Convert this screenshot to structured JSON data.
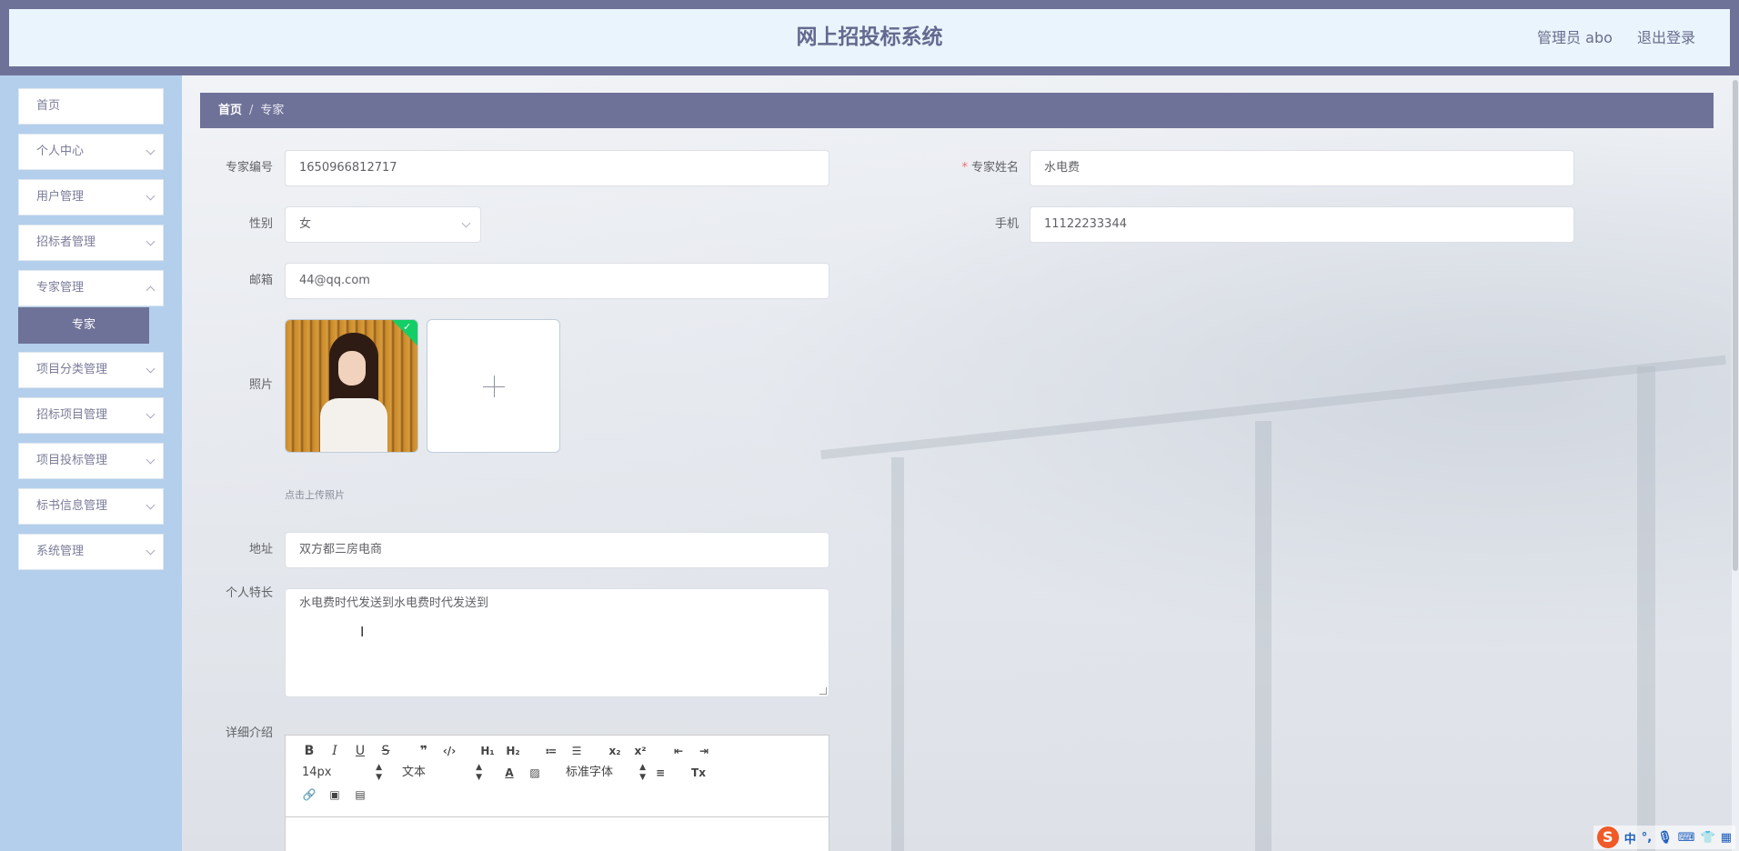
{
  "header": {
    "title": "网上招投标系统",
    "user_label": "管理员 abo",
    "logout_label": "退出登录"
  },
  "sidebar": {
    "items": [
      {
        "label": "首页"
      },
      {
        "label": "个人中心"
      },
      {
        "label": "用户管理"
      },
      {
        "label": "招标者管理"
      },
      {
        "label": "专家管理"
      },
      {
        "label": "项目分类管理"
      },
      {
        "label": "招标项目管理"
      },
      {
        "label": "项目投标管理"
      },
      {
        "label": "标书信息管理"
      },
      {
        "label": "系统管理"
      }
    ],
    "active_sub": "专家"
  },
  "breadcrumb": {
    "home": "首页",
    "sep": "/",
    "current": "专家"
  },
  "form": {
    "expert_no_label": "专家编号",
    "expert_no_value": "1650966812717",
    "expert_name_label": "专家姓名",
    "expert_name_required": "*",
    "expert_name_value": "水电费",
    "gender_label": "性别",
    "gender_value": "女",
    "phone_label": "手机",
    "phone_value": "11122233344",
    "email_label": "邮箱",
    "email_value": "44@qq.com",
    "photo_label": "照片",
    "photo_hint": "点击上传照片",
    "address_label": "地址",
    "address_value": "双方都三房电商",
    "specialty_label": "个人特长",
    "specialty_value": "水电费时代发送到水电费时代发送到",
    "detail_label": "详细介绍"
  },
  "editor": {
    "font_size": "14px",
    "format": "文本",
    "font": "标准字体"
  },
  "ime": {
    "lang": "中"
  },
  "colors": {
    "accent": "#6f7298",
    "sidebar_bg": "#b3cfec",
    "header_bg": "#e9f4fc",
    "required": "#f56c6c",
    "success": "#13ce66"
  }
}
